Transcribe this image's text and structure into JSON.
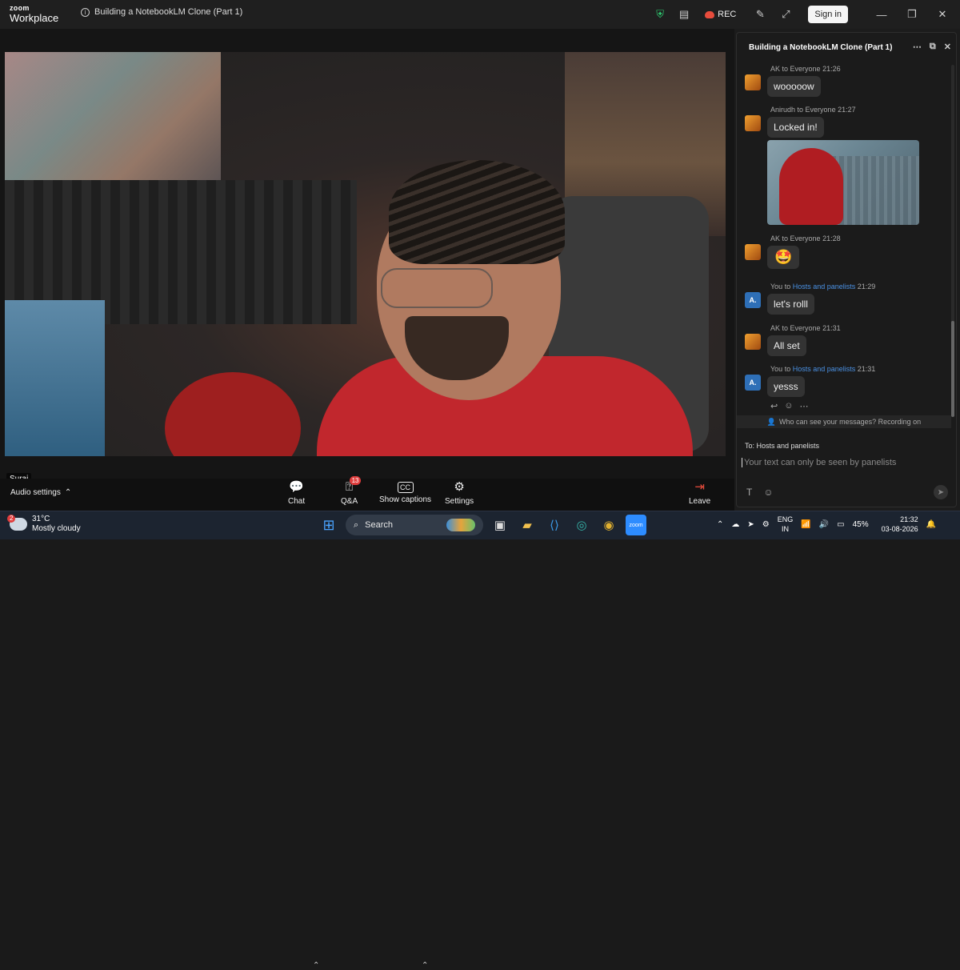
{
  "app": {
    "logo_top": "zoom",
    "logo_bottom": "Workplace",
    "meeting_title": "Building a NotebookLM Clone (Part 1)"
  },
  "titlebar": {
    "rec_label": "REC",
    "signin_label": "Sign in"
  },
  "video": {
    "participant_name": "Suraj"
  },
  "toolbar": {
    "audio_settings": "Audio settings",
    "chat": "Chat",
    "qa": "Q&A",
    "qa_badge": "13",
    "captions": "Show captions",
    "settings": "Settings",
    "leave": "Leave"
  },
  "chat": {
    "title": "Building a NotebookLM Clone (Part 1)",
    "messages": [
      {
        "sender": "AK",
        "to_prefix": " to ",
        "to": "Everyone",
        "time": "21:26",
        "text": "wooooow"
      },
      {
        "sender": "Anirudh",
        "to_prefix": " to ",
        "to": "Everyone",
        "time": "21:27",
        "text": "Locked in!"
      },
      {
        "sender": "AK",
        "to_prefix": " to ",
        "to": "Everyone",
        "time": "21:28",
        "text": "🤩"
      },
      {
        "sender": "You",
        "to_prefix": " to ",
        "to": "Hosts and panelists",
        "time": "21:29",
        "text": "let's rolll",
        "avatar": "A."
      },
      {
        "sender": "AK",
        "to_prefix": " to ",
        "to": "Everyone",
        "time": "21:31",
        "text": "All set"
      },
      {
        "sender": "You",
        "to_prefix": " to ",
        "to": "Hosts and panelists",
        "time": "21:31",
        "text": "yesss",
        "avatar": "A."
      }
    ],
    "privacy_note": "Who can see your messages? Recording on",
    "to_line": "To:  Hosts and panelists",
    "compose_placeholder": "Your text can only be seen by panelists"
  },
  "taskbar": {
    "weather_badge": "2",
    "temperature": "31°C",
    "condition": "Mostly cloudy",
    "search": "Search",
    "lang_top": "ENG",
    "lang_bottom": "IN",
    "battery": "45%",
    "time": "21:32",
    "date": "03-08-2026"
  },
  "colors": {
    "accent_blue": "#4a90e2",
    "badge_red": "#e03c3c",
    "shield_green": "#2ecc71"
  }
}
